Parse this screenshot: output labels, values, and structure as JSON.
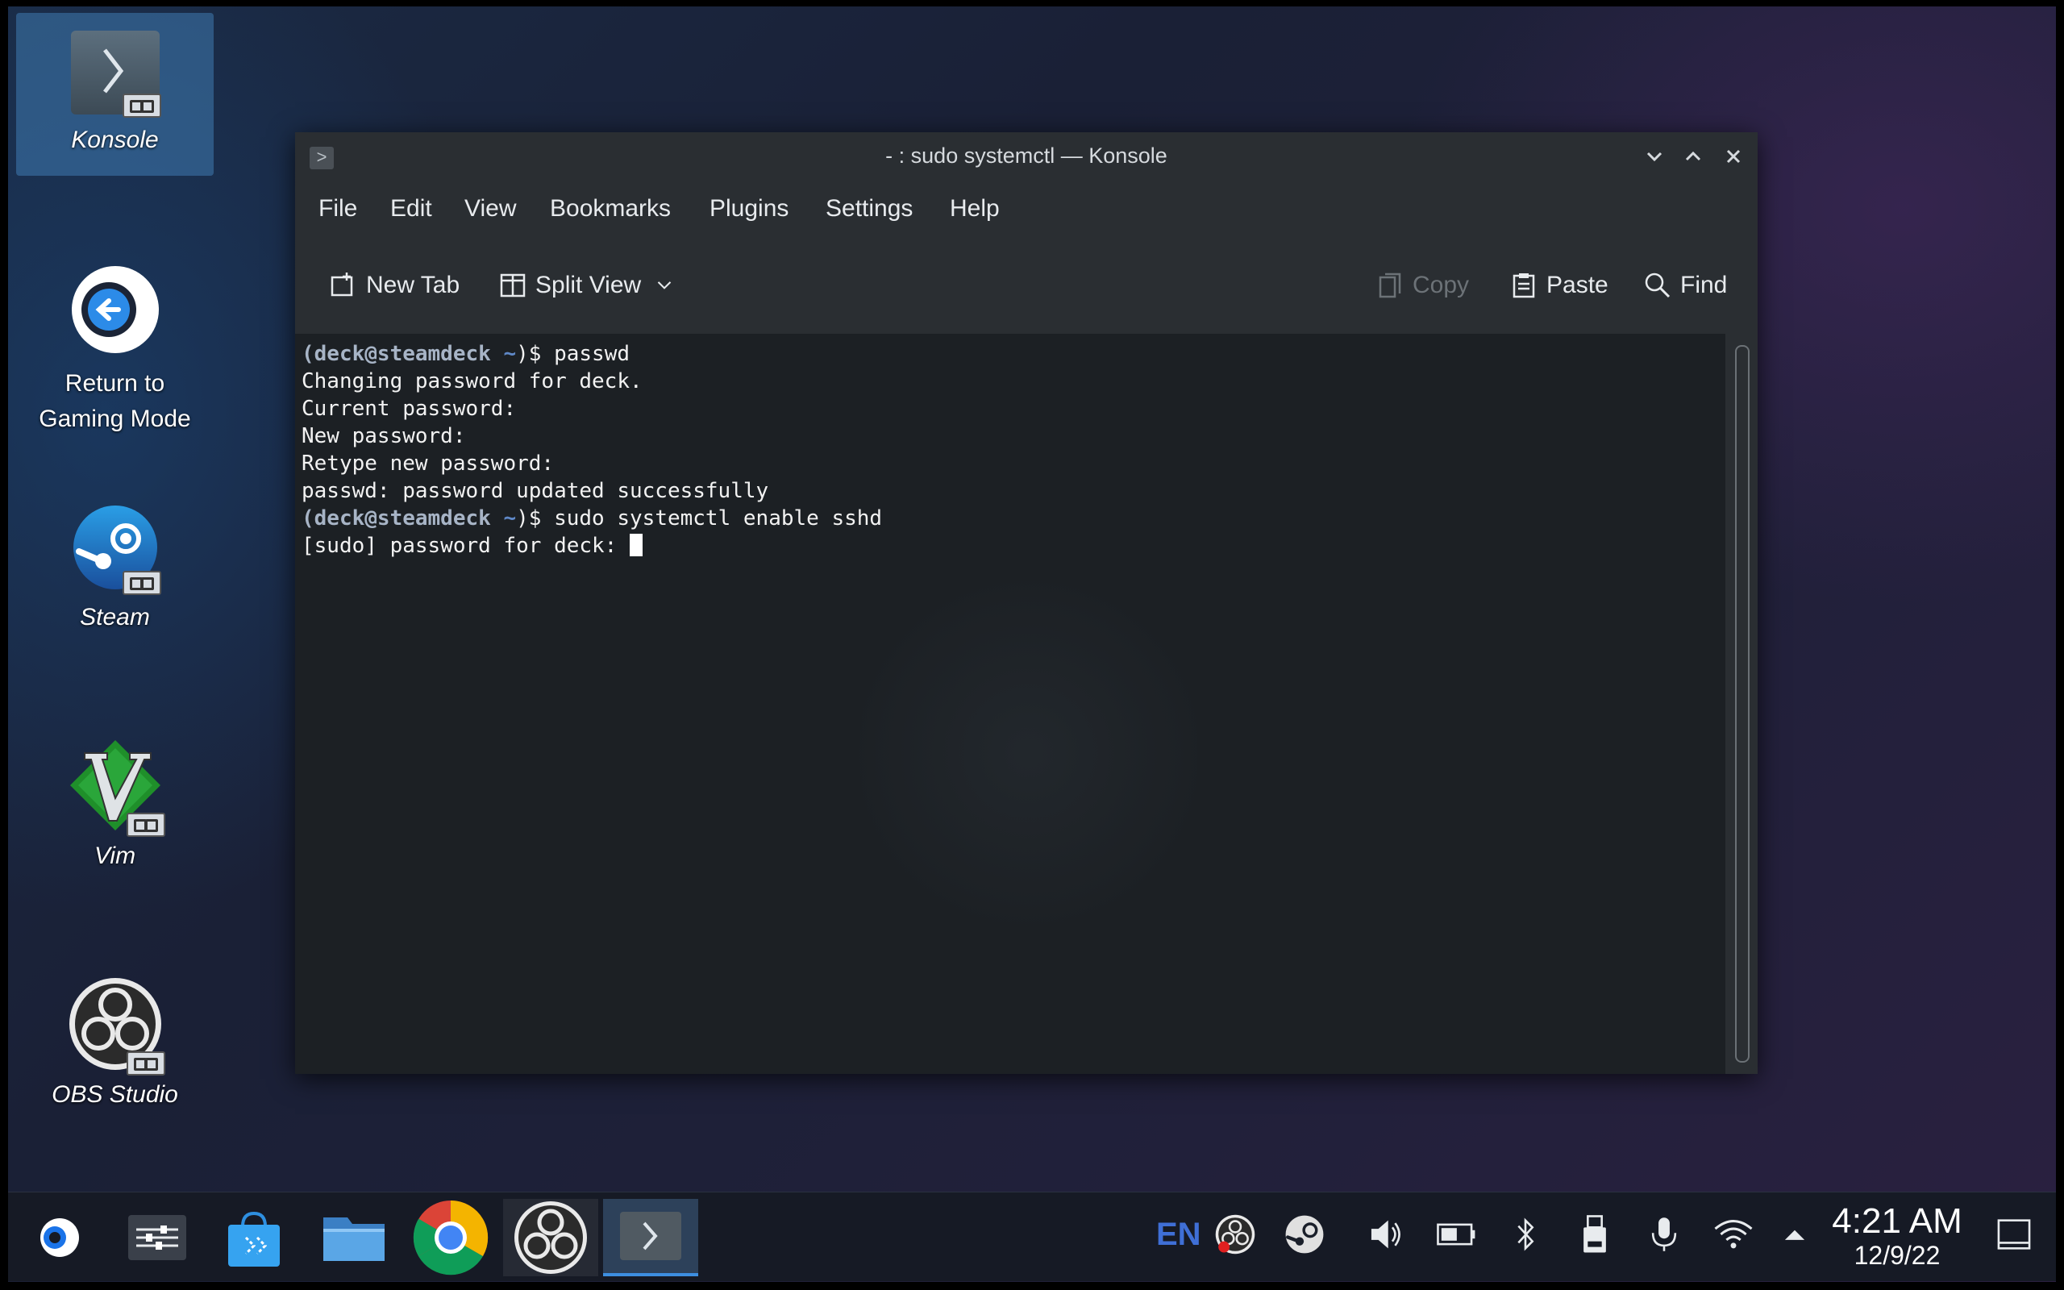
{
  "desktop": {
    "icons": [
      {
        "label": "Konsole"
      },
      {
        "label": "Return to\nGaming Mode"
      },
      {
        "label": "Steam"
      },
      {
        "label": "Vim"
      },
      {
        "label": "OBS Studio"
      }
    ]
  },
  "window": {
    "title": "- : sudo systemctl — Konsole",
    "menu": [
      "File",
      "Edit",
      "View",
      "Bookmarks",
      "Plugins",
      "Settings",
      "Help"
    ],
    "toolbar": {
      "new_tab": "New Tab",
      "split_view": "Split View",
      "copy": "Copy",
      "paste": "Paste",
      "find": "Find"
    },
    "terminal": {
      "prompt_user": "(deck@steamdeck",
      "prompt_tilde": " ~",
      "prompt_end": ")$ ",
      "lines": [
        {
          "type": "cmd",
          "text": "passwd"
        },
        {
          "type": "out",
          "text": "Changing password for deck."
        },
        {
          "type": "out",
          "text": "Current password:"
        },
        {
          "type": "out",
          "text": "New password:"
        },
        {
          "type": "out",
          "text": "Retype new password:"
        },
        {
          "type": "out",
          "text": "passwd: password updated successfully"
        },
        {
          "type": "cmd",
          "text": "sudo systemctl enable sshd"
        },
        {
          "type": "out",
          "text": "[sudo] password for deck: ",
          "cursor": true
        }
      ]
    }
  },
  "taskbar": {
    "language": "EN",
    "time": "4:21 AM",
    "date": "12/9/22",
    "tasks": [
      "steam-menu-icon",
      "settings-icon",
      "discover-store-icon",
      "file-manager-icon",
      "chrome-icon",
      "obs-icon",
      "konsole-icon"
    ],
    "tray": [
      "obs-tray-icon",
      "steam-tray-icon",
      "volume-icon",
      "battery-icon",
      "bluetooth-icon",
      "usb-device-icon",
      "microphone-icon",
      "wifi-icon",
      "tray-expand-icon",
      "show-desktop-icon"
    ]
  },
  "colors": {
    "accent": "#3d8ee0",
    "terminal_bg": "#1c2024",
    "window_chrome": "#2a2e32",
    "prompt": "#a7b4c6",
    "prompt_tilde": "#5f88c7"
  }
}
